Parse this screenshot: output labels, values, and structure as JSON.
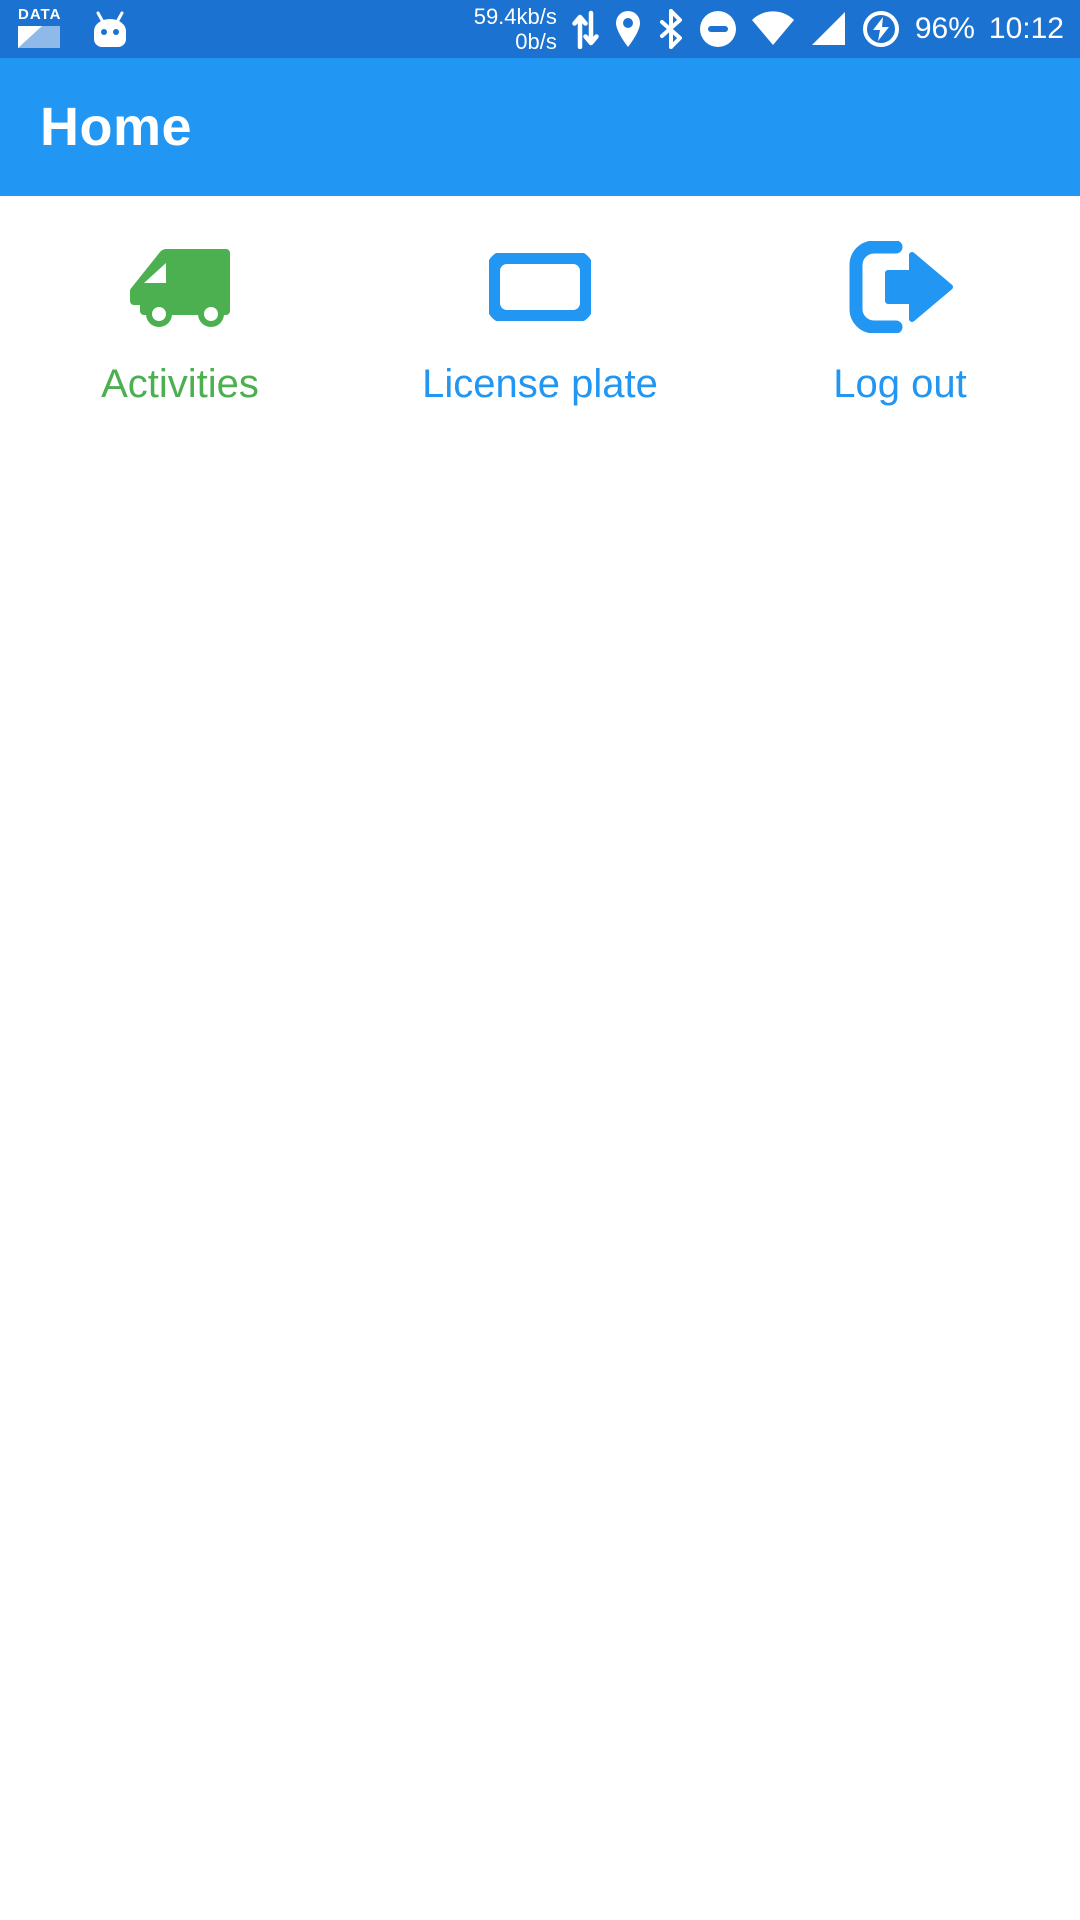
{
  "status_bar": {
    "data_badge_label": "DATA",
    "network_speed_down": "59.4kb/s",
    "network_speed_up": "0b/s",
    "battery_percent": "96%",
    "clock": "10:12",
    "icons": [
      "data-usage-icon",
      "android-mascot-icon",
      "network-transfer-icon",
      "location-pin-icon",
      "bluetooth-icon",
      "do-not-disturb-icon",
      "wifi-icon",
      "cellular-signal-icon",
      "battery-charging-icon"
    ],
    "background_color": "#1b72d0",
    "foreground_color": "#ffffff"
  },
  "app_bar": {
    "title": "Home",
    "background_color": "#2196f3",
    "title_color": "#ffffff"
  },
  "main": {
    "items": [
      {
        "label": "Activities",
        "icon": "delivery-truck-icon",
        "color": "#4caf50"
      },
      {
        "label": "License plate",
        "icon": "license-plate-icon",
        "color": "#2196f3"
      },
      {
        "label": "Log out",
        "icon": "logout-arrow-icon",
        "color": "#2196f3"
      }
    ]
  }
}
